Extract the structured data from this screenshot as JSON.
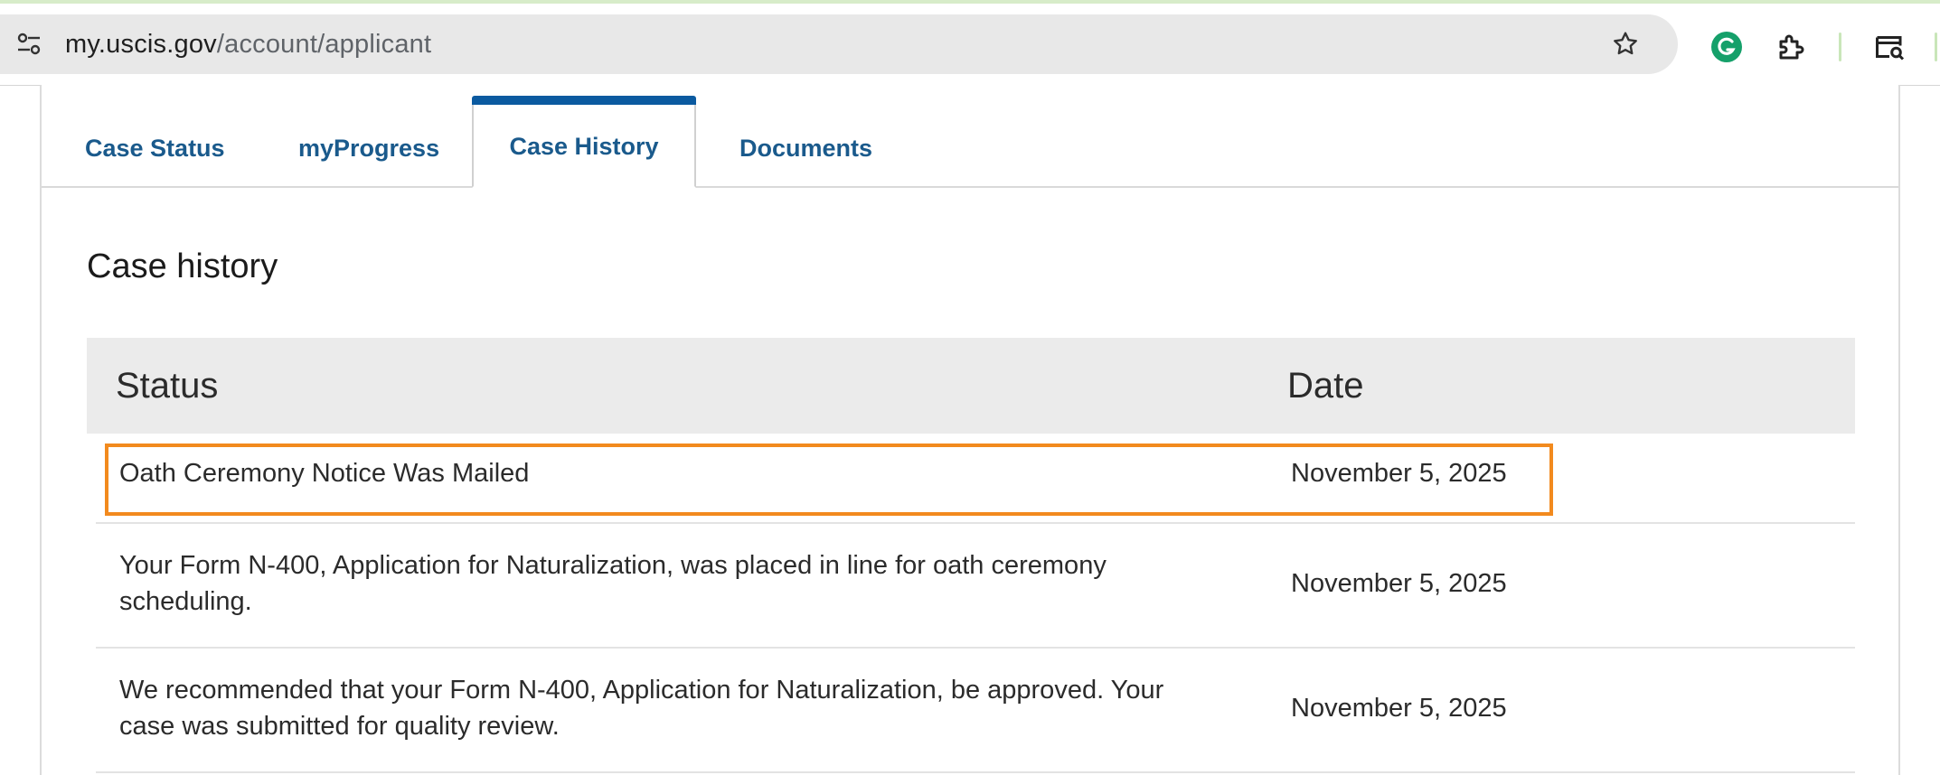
{
  "browser": {
    "url_domain": "my.uscis.gov",
    "url_path": "/account/applicant"
  },
  "tabs": [
    {
      "label": "Case Status",
      "active": false
    },
    {
      "label": "myProgress",
      "active": false
    },
    {
      "label": "Case History",
      "active": true
    },
    {
      "label": "Documents",
      "active": false
    }
  ],
  "section_title": "Case history",
  "table": {
    "headers": {
      "status": "Status",
      "date": "Date"
    },
    "rows": [
      {
        "status": "Oath Ceremony Notice Was Mailed",
        "date": "November 5, 2025",
        "highlighted": true
      },
      {
        "status": "Your Form N-400, Application for Naturalization, was placed in line for oath ceremony scheduling.",
        "date": "November 5, 2025",
        "highlighted": false
      },
      {
        "status": "We recommended that your Form N-400, Application for Naturalization, be approved. Your case was submitted for quality review.",
        "date": "November 5, 2025",
        "highlighted": false
      }
    ]
  },
  "colors": {
    "tab_text": "#1a5a8c",
    "active_tab_bar": "#0b5aa0",
    "highlight_border": "#f28a1e",
    "table_header_bg": "#ebebeb"
  },
  "icons": [
    "site-info-icon",
    "bookmark-star-icon",
    "grammarly-icon",
    "extensions-icon",
    "tab-search-icon"
  ]
}
